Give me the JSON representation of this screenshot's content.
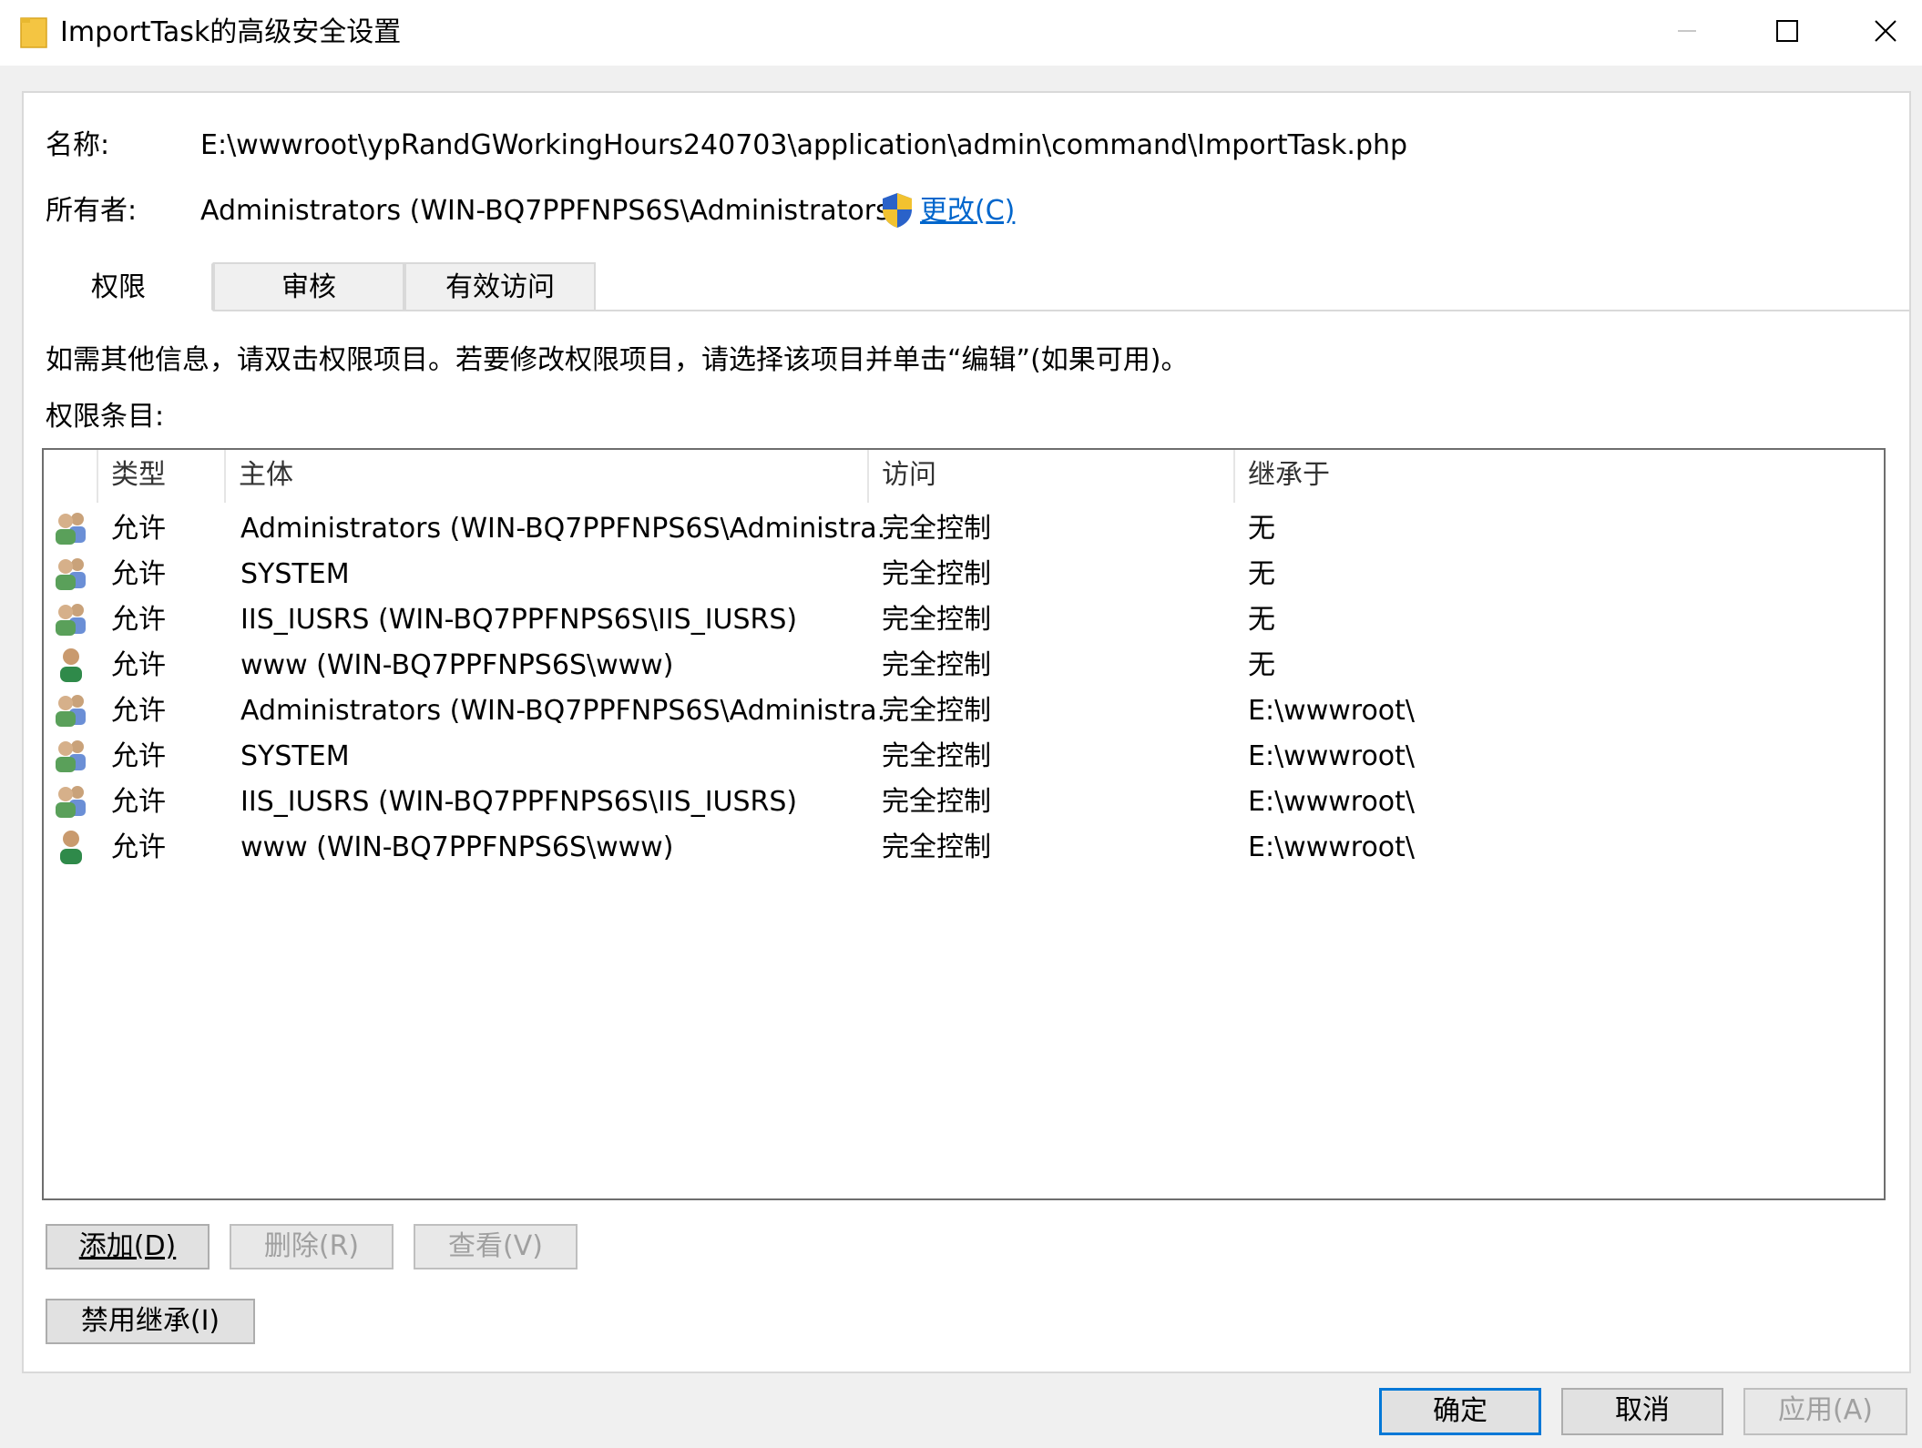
{
  "window": {
    "title": "ImportTask的高级安全设置",
    "minimize_icon": "minimize-icon",
    "maximize_icon": "maximize-icon",
    "close_icon": "close-icon"
  },
  "header": {
    "name_label": "名称:",
    "name_value": "E:\\wwwroot\\ypRandGWorkingHours240703\\application\\admin\\command\\ImportTask.php",
    "owner_label": "所有者:",
    "owner_value": "Administrators (WIN-BQ7PPFNPS6S\\Administrators)",
    "change_link": "更改(C)"
  },
  "tabs": [
    {
      "label": "权限",
      "active": true
    },
    {
      "label": "审核",
      "active": false
    },
    {
      "label": "有效访问",
      "active": false
    }
  ],
  "info_text": "如需其他信息，请双击权限项目。若要修改权限项目，请选择该项目并单击“编辑”(如果可用)。",
  "entries_label": "权限条目:",
  "columns": {
    "type": "类型",
    "principal": "主体",
    "access": "访问",
    "inherited": "继承于"
  },
  "rows": [
    {
      "icon": "group-icon",
      "type": "允许",
      "principal": "Administrators (WIN-BQ7PPFNPS6S\\Administra...",
      "access": "完全控制",
      "inherited": "无"
    },
    {
      "icon": "group-icon",
      "type": "允许",
      "principal": "SYSTEM",
      "access": "完全控制",
      "inherited": "无"
    },
    {
      "icon": "group-icon",
      "type": "允许",
      "principal": "IIS_IUSRS (WIN-BQ7PPFNPS6S\\IIS_IUSRS)",
      "access": "完全控制",
      "inherited": "无"
    },
    {
      "icon": "user-icon",
      "type": "允许",
      "principal": "www (WIN-BQ7PPFNPS6S\\www)",
      "access": "完全控制",
      "inherited": "无"
    },
    {
      "icon": "group-icon",
      "type": "允许",
      "principal": "Administrators (WIN-BQ7PPFNPS6S\\Administra...",
      "access": "完全控制",
      "inherited": "E:\\wwwroot\\"
    },
    {
      "icon": "group-icon",
      "type": "允许",
      "principal": "SYSTEM",
      "access": "完全控制",
      "inherited": "E:\\wwwroot\\"
    },
    {
      "icon": "group-icon",
      "type": "允许",
      "principal": "IIS_IUSRS (WIN-BQ7PPFNPS6S\\IIS_IUSRS)",
      "access": "完全控制",
      "inherited": "E:\\wwwroot\\"
    },
    {
      "icon": "user-icon",
      "type": "允许",
      "principal": "www (WIN-BQ7PPFNPS6S\\www)",
      "access": "完全控制",
      "inherited": "E:\\wwwroot\\"
    }
  ],
  "buttons": {
    "add": "添加(D)",
    "remove": "删除(R)",
    "view": "查看(V)",
    "disable_inheritance": "禁用继承(I)",
    "ok": "确定",
    "cancel": "取消",
    "apply": "应用(A)"
  },
  "colors": {
    "link": "#0066cc",
    "primary_border": "#0078d7"
  }
}
